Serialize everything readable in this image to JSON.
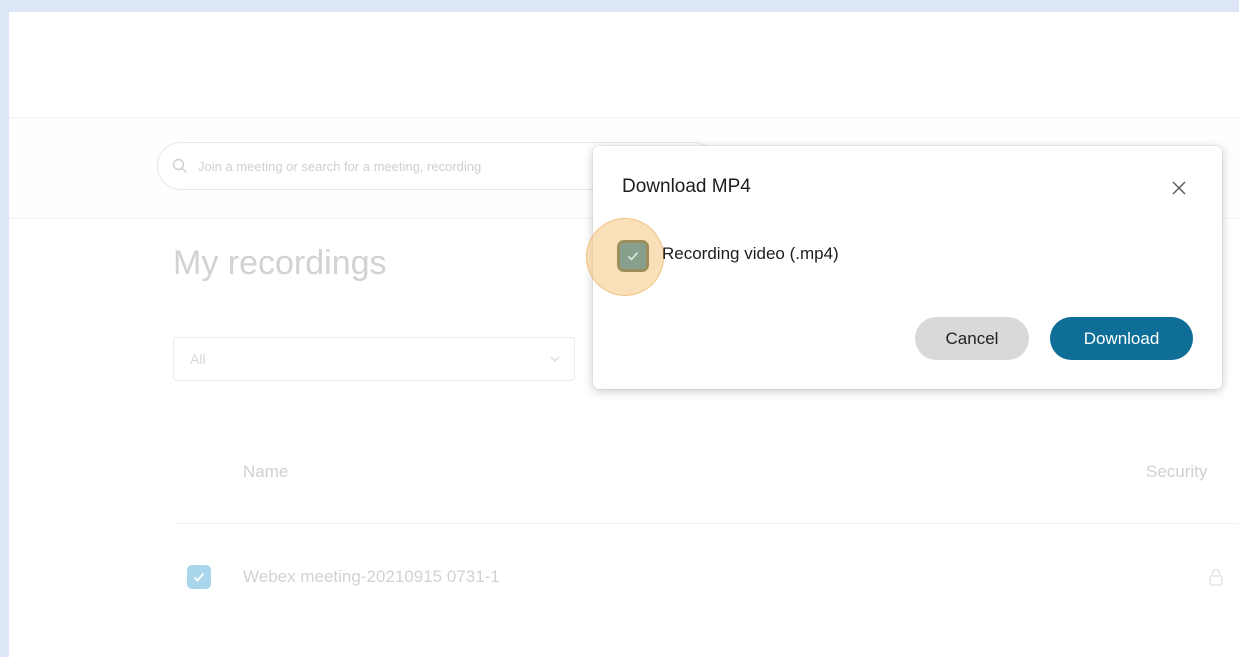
{
  "search": {
    "placeholder": "Join a meeting or search for a meeting, recording"
  },
  "page": {
    "title": "My recordings"
  },
  "filter": {
    "selected": "All"
  },
  "table": {
    "columns": [
      "Name",
      "Security"
    ],
    "rows": [
      {
        "name": "Webex meeting-20210915 0731-1",
        "checked": true
      }
    ]
  },
  "dialog": {
    "title": "Download MP4",
    "option_label": "Recording video (.mp4)",
    "option_checked": true,
    "cancel_label": "Cancel",
    "download_label": "Download"
  },
  "colors": {
    "accent": "#0f6e97",
    "background": "#dde6f6",
    "highlight": "#f6c67d"
  }
}
